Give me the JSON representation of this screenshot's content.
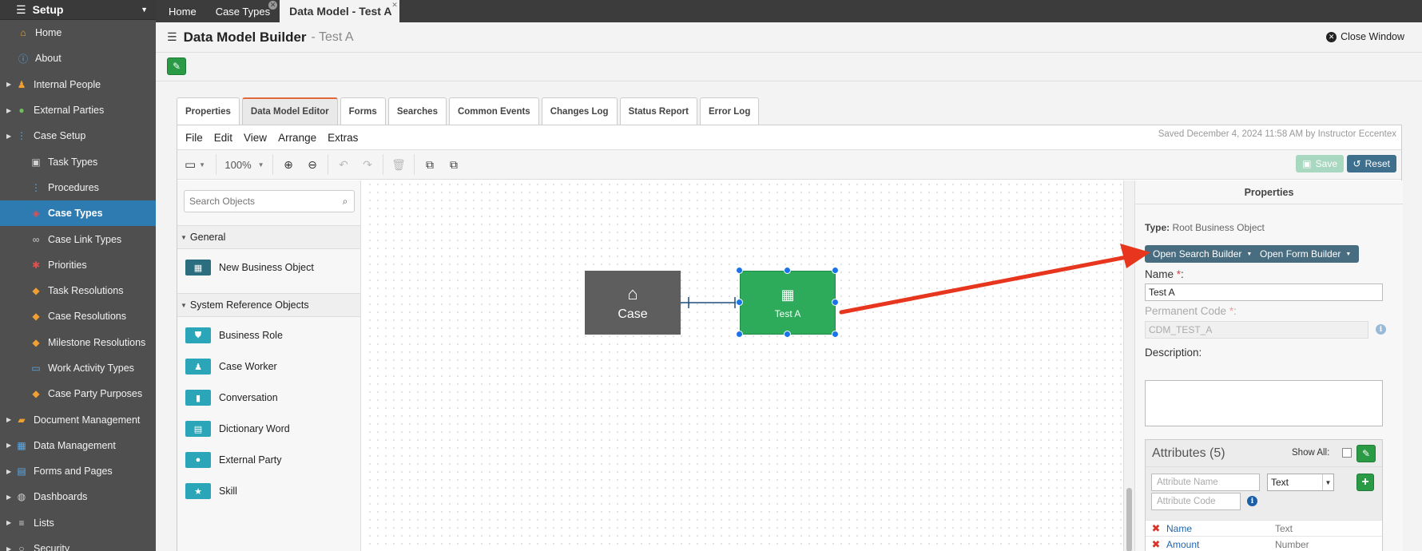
{
  "sidebar": {
    "title": "Setup",
    "items": [
      {
        "label": "Home",
        "level": 1,
        "icon": "home-icon",
        "glyph": "⌂"
      },
      {
        "label": "About",
        "level": 1,
        "icon": "info-icon",
        "glyph": "ⓘ"
      },
      {
        "label": "Internal People",
        "level": 0,
        "icon": "people-icon",
        "glyph": "♟"
      },
      {
        "label": "External Parties",
        "level": 0,
        "icon": "globe-icon",
        "glyph": "●"
      },
      {
        "label": "Case Setup",
        "level": 0,
        "icon": "hierarchy-icon",
        "glyph": "⋮"
      },
      {
        "label": "Task Types",
        "level": 2,
        "icon": "cube-icon",
        "glyph": "▣"
      },
      {
        "label": "Procedures",
        "level": 2,
        "icon": "procedure-icon",
        "glyph": "⋮"
      },
      {
        "label": "Case Types",
        "level": 2,
        "icon": "case-types-icon",
        "glyph": "◈",
        "active": true
      },
      {
        "label": "Case Link Types",
        "level": 2,
        "icon": "link-icon",
        "glyph": "∞"
      },
      {
        "label": "Priorities",
        "level": 2,
        "icon": "asterisk-icon",
        "glyph": "✱"
      },
      {
        "label": "Task Resolutions",
        "level": 2,
        "icon": "tag-icon",
        "glyph": "◆"
      },
      {
        "label": "Case Resolutions",
        "level": 2,
        "icon": "tag-icon",
        "glyph": "◆"
      },
      {
        "label": "Milestone Resolutions",
        "level": 2,
        "icon": "tag-icon",
        "glyph": "◆"
      },
      {
        "label": "Work Activity Types",
        "level": 2,
        "icon": "monitor-icon",
        "glyph": "▭"
      },
      {
        "label": "Case Party Purposes",
        "level": 2,
        "icon": "tag-icon",
        "glyph": "◆"
      },
      {
        "label": "Document Management",
        "level": 0,
        "icon": "folder-icon",
        "glyph": "▰"
      },
      {
        "label": "Data Management",
        "level": 0,
        "icon": "table-icon",
        "glyph": "▦"
      },
      {
        "label": "Forms and Pages",
        "level": 0,
        "icon": "form-icon",
        "glyph": "▤"
      },
      {
        "label": "Dashboards",
        "level": 0,
        "icon": "dashboard-icon",
        "glyph": "◍"
      },
      {
        "label": "Lists",
        "level": 0,
        "icon": "list-icon",
        "glyph": "≡"
      },
      {
        "label": "Security",
        "level": 0,
        "icon": "lock-icon",
        "glyph": "○"
      }
    ]
  },
  "tabs": [
    {
      "label": "Home",
      "closable": false
    },
    {
      "label": "Case Types",
      "closable": true
    },
    {
      "label": "Data Model - Test A",
      "closable": true,
      "active": true
    }
  ],
  "header": {
    "title": "Data Model Builder",
    "subtitle": "- Test A",
    "close_label": "Close Window"
  },
  "main_tabs": [
    "Properties",
    "Data Model Editor",
    "Forms",
    "Searches",
    "Common Events",
    "Changes Log",
    "Status Report",
    "Error Log"
  ],
  "menu": [
    "File",
    "Edit",
    "View",
    "Arrange",
    "Extras"
  ],
  "saved_text": "Saved December 4, 2024 11:58 AM by Instructor Eccentex",
  "toolbar": {
    "zoom": "100%",
    "save_label": "Save",
    "reset_label": "Reset"
  },
  "objects": {
    "search_placeholder": "Search Objects",
    "groups": [
      {
        "label": "General",
        "items": [
          {
            "label": "New Business Object",
            "icon": "table-icon",
            "glyph": "▦"
          }
        ]
      },
      {
        "label": "System Reference Objects",
        "items": [
          {
            "label": "Business Role",
            "icon": "shield-icon",
            "glyph": "⛊"
          },
          {
            "label": "Case Worker",
            "icon": "user-icon",
            "glyph": "♟"
          },
          {
            "label": "Conversation",
            "icon": "book-icon",
            "glyph": "▮"
          },
          {
            "label": "Dictionary Word",
            "icon": "document-icon",
            "glyph": "▤"
          },
          {
            "label": "External Party",
            "icon": "globe-icon",
            "glyph": "●"
          },
          {
            "label": "Skill",
            "icon": "star-icon",
            "glyph": "★"
          }
        ]
      }
    ]
  },
  "canvas": {
    "case_label": "Case",
    "node_label": "Test A"
  },
  "properties": {
    "title": "Properties",
    "type_label": "Type:",
    "type_value": "Root Business Object",
    "open_search_builder": "Open Search Builder",
    "open_form_builder": "Open Form Builder",
    "name_label": "Name",
    "name_value": "Test A",
    "permanent_code_label": "Permanent Code",
    "permanent_code_value": "CDM_TEST_A",
    "description_label": "Description:",
    "attributes_title": "Attributes (5)",
    "show_all_label": "Show All:",
    "attribute_name_placeholder": "Attribute Name",
    "attribute_code_placeholder": "Attribute Code",
    "attribute_type_selected": "Text",
    "attributes": [
      {
        "name": "Name",
        "type": "Text"
      },
      {
        "name": "Amount",
        "type": "Number"
      }
    ]
  },
  "colors": {
    "accent_green": "#2daa5a",
    "arrow_red": "#e8361e",
    "active_nav": "#2e7bb2"
  }
}
